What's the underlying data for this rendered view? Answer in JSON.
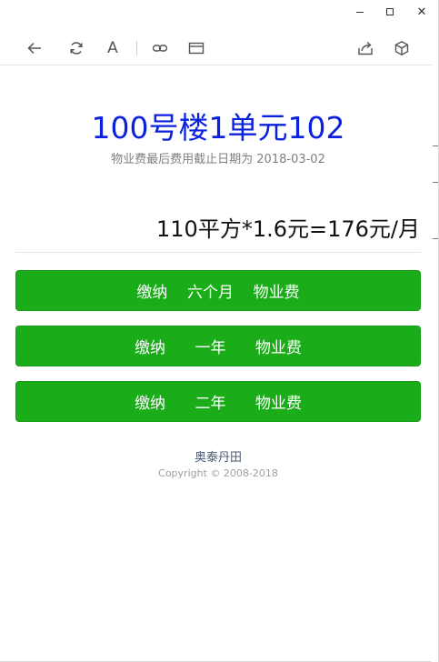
{
  "window": {
    "minimize_icon": "minimize-icon",
    "maximize_icon": "maximize-icon",
    "close_label": "✕"
  },
  "toolbar": {
    "font_label": "A"
  },
  "main": {
    "unit_title": "100号楼1单元102",
    "deadline_text": "物业费最后费用截止日期为 2018-03-02",
    "fee_formula": "110平方*1.6元=176元/月",
    "buttons": [
      {
        "label": "缴纳    六个月    物业费"
      },
      {
        "label": "缴纳      一年      物业费"
      },
      {
        "label": "缴纳      二年      物业费"
      }
    ]
  },
  "footer": {
    "name": "奥泰丹田",
    "copyright": "Copyright © 2008-2018"
  },
  "colors": {
    "title_blue": "#0b21e0",
    "button_green": "#1aad19"
  }
}
